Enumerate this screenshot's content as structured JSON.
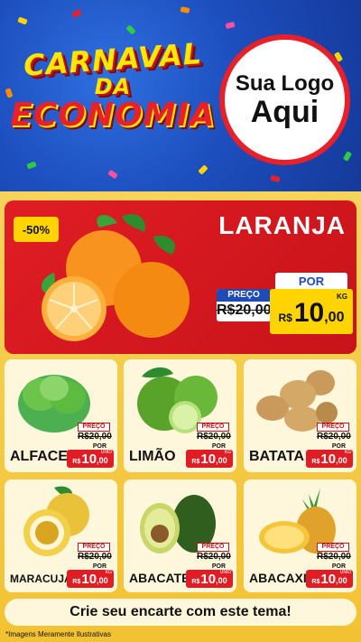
{
  "header": {
    "title_line1": "CARNAVAL",
    "title_line2": "DA",
    "title_line3": "ECONOMIA",
    "logo_line1": "Sua Logo",
    "logo_line2": "Aqui"
  },
  "featured": {
    "discount": "-50%",
    "name": "LARANJA",
    "por_label": "POR",
    "preco_label": "PREÇO",
    "old_price": "R$20,00",
    "currency": "R$",
    "price_int": "10",
    "price_dec": ",00",
    "unit": "KG",
    "image_icon": "orange-icon"
  },
  "products": [
    {
      "name": "ALFACE",
      "preco_label": "PREÇO",
      "old_price": "R$20,00",
      "por_label": "POR",
      "currency": "R$",
      "price_int": "10",
      "price_dec": ",00",
      "unit": "UNID",
      "icon": "lettuce-icon"
    },
    {
      "name": "LIMÃO",
      "preco_label": "PREÇO",
      "old_price": "R$20,00",
      "por_label": "POR",
      "currency": "R$",
      "price_int": "10",
      "price_dec": ",00",
      "unit": "KG",
      "icon": "lime-icon"
    },
    {
      "name": "BATATA",
      "preco_label": "PREÇO",
      "old_price": "R$20,00",
      "por_label": "POR",
      "currency": "R$",
      "price_int": "10",
      "price_dec": ",00",
      "unit": "KG",
      "icon": "potato-icon"
    },
    {
      "name": "MARACUJÁ",
      "preco_label": "PREÇO",
      "old_price": "R$20,00",
      "por_label": "POR",
      "currency": "R$",
      "price_int": "10",
      "price_dec": ",00",
      "unit": "KG",
      "icon": "passion-fruit-icon"
    },
    {
      "name": "ABACATE",
      "preco_label": "PREÇO",
      "old_price": "R$20,00",
      "por_label": "POR",
      "currency": "R$",
      "price_int": "10",
      "price_dec": ",00",
      "unit": "UNID",
      "icon": "avocado-icon"
    },
    {
      "name": "ABACAXI",
      "preco_label": "PREÇO",
      "old_price": "R$20,00",
      "por_label": "POR",
      "currency": "R$",
      "price_int": "10",
      "price_dec": ",00",
      "unit": "UNID",
      "icon": "pineapple-icon"
    }
  ],
  "cta": "Crie seu encarte com este tema!",
  "footnote": "*Imagens Meramente Ilustrativas",
  "colors": {
    "red": "#e01d24",
    "yellow": "#ffd400",
    "blue": "#1e4bb5",
    "background": "#f2c232"
  }
}
